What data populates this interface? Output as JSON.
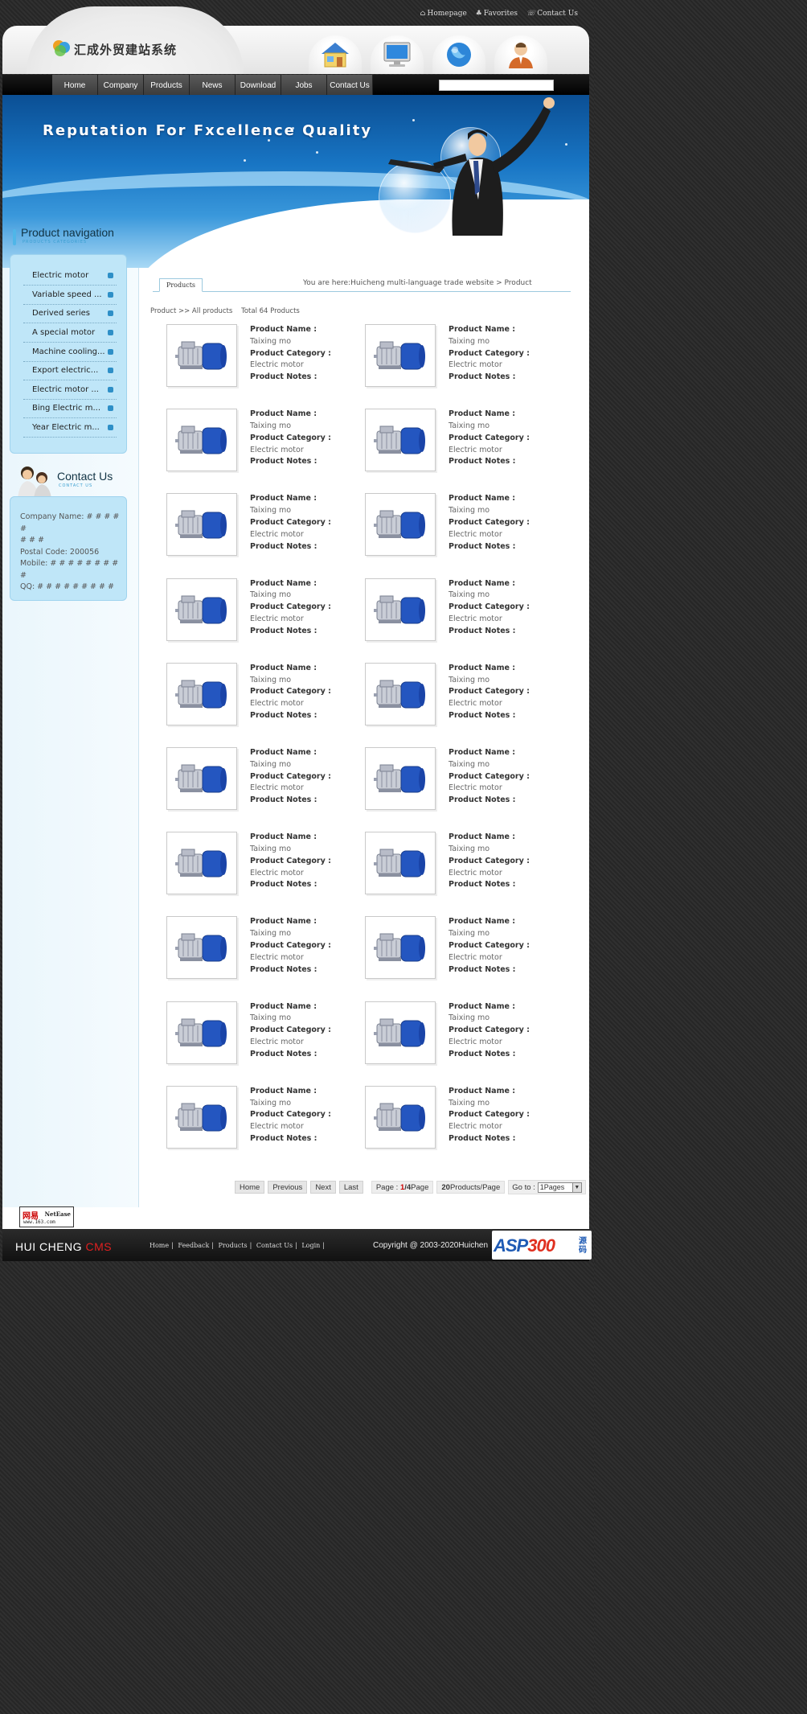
{
  "top_links": [
    {
      "icon": "home-icon",
      "label": "Homepage"
    },
    {
      "icon": "favorites-icon",
      "label": "Favorites"
    },
    {
      "icon": "contact-icon",
      "label": "Contact Us"
    }
  ],
  "logo": {
    "text": "汇成外贸建站系统"
  },
  "header_icons": [
    "house-icon",
    "monitor-icon",
    "globe-icon",
    "person-icon"
  ],
  "nav": {
    "items": [
      "Home",
      "Company",
      "Products",
      "News",
      "Download",
      "Jobs",
      "Contact Us"
    ],
    "search_value": ""
  },
  "banner": {
    "slogan": "Reputation For Fxcellence Quality"
  },
  "sidebar": {
    "product_nav_title": "Product navigation",
    "product_nav_sub": "PRODUCTS CATEGORIES",
    "categories": [
      "Electric motor",
      "Variable speed ...",
      "Derived series",
      "A special motor",
      "Machine cooling...",
      "Export electric...",
      "Electric motor ...",
      "Bing Electric m...",
      "Year Electric m..."
    ],
    "contact_title": "Contact Us",
    "contact_sub": "CONTACT US",
    "contact_lines": [
      "Company Name: # # # # #",
      "# # #",
      "Postal Code: 200056",
      "Mobile: # # # # # # # # #",
      "QQ: # # # # # # # # #"
    ]
  },
  "content": {
    "tab": "Products",
    "breadcrumb": "You are here:Huicheng multi-language trade website > Product",
    "list_header": "Product >> All products    Total 64 Products",
    "labels": {
      "name": "Product Name :",
      "category": "Product Category :",
      "notes": "Product Notes :"
    },
    "products": [
      {
        "name": "Taixing mo",
        "category": "Electric motor"
      },
      {
        "name": "Taixing mo",
        "category": "Electric motor"
      },
      {
        "name": "Taixing mo",
        "category": "Electric motor"
      },
      {
        "name": "Taixing mo",
        "category": "Electric motor"
      },
      {
        "name": "Taixing mo",
        "category": "Electric motor"
      },
      {
        "name": "Taixing mo",
        "category": "Electric motor"
      },
      {
        "name": "Taixing mo",
        "category": "Electric motor"
      },
      {
        "name": "Taixing mo",
        "category": "Electric motor"
      },
      {
        "name": "Taixing mo",
        "category": "Electric motor"
      },
      {
        "name": "Taixing mo",
        "category": "Electric motor"
      },
      {
        "name": "Taixing mo",
        "category": "Electric motor"
      },
      {
        "name": "Taixing mo",
        "category": "Electric motor"
      },
      {
        "name": "Taixing mo",
        "category": "Electric motor"
      },
      {
        "name": "Taixing mo",
        "category": "Electric motor"
      },
      {
        "name": "Taixing mo",
        "category": "Electric motor"
      },
      {
        "name": "Taixing mo",
        "category": "Electric motor"
      },
      {
        "name": "Taixing mo",
        "category": "Electric motor"
      },
      {
        "name": "Taixing mo",
        "category": "Electric motor"
      },
      {
        "name": "Taixing mo",
        "category": "Electric motor"
      },
      {
        "name": "Taixing mo",
        "category": "Electric motor"
      }
    ]
  },
  "pager": {
    "home": "Home",
    "previous": "Previous",
    "next": "Next",
    "last": "Last",
    "page_prefix": "Page : ",
    "page_current": "1",
    "page_total": "/4",
    "page_suffix": "Page",
    "per_page_count": "20",
    "per_page_suffix": "Products/Page",
    "goto_label": "Go to :",
    "goto_selected": "1Pages"
  },
  "badge": {
    "cn": "网易",
    "en": "NetEase",
    "url": "www.163.com"
  },
  "footer": {
    "brand_main": "HUI CHENG",
    "brand_cms": " CMS",
    "links": [
      "Home",
      "Feedback",
      "Products",
      "Contact Us",
      "Login"
    ],
    "copyright": "Copyright @ 2003-2020Huichen"
  },
  "watermark": {
    "text_a": "ASP",
    "text_b": "300",
    "cn": "源码"
  },
  "colors": {
    "accent": "#1875c4",
    "sidebar_box": "#bfe6f8",
    "brand_red": "#e02020"
  }
}
